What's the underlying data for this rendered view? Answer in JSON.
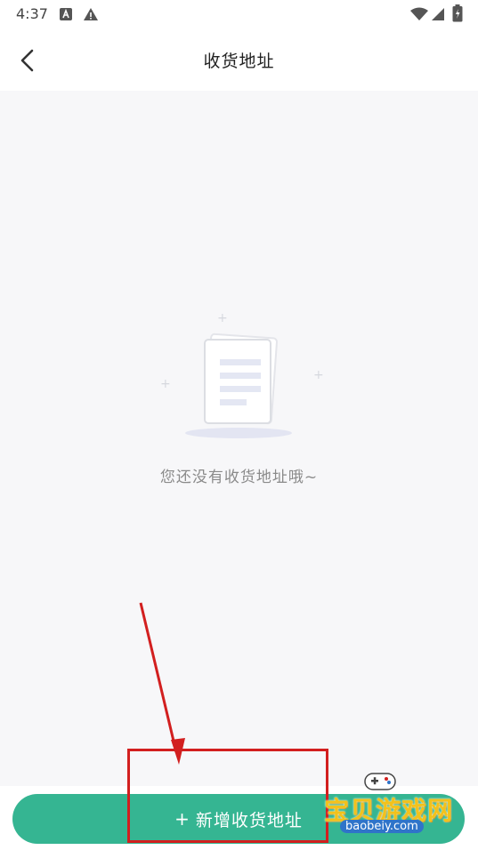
{
  "status_bar": {
    "time": "4:37"
  },
  "header": {
    "title": "收货地址"
  },
  "empty_state": {
    "message": "您还没有收货地址哦~"
  },
  "footer": {
    "add_button_label": "新增收货地址",
    "add_button_prefix": "+"
  },
  "watermark": {
    "text": "宝贝游戏网",
    "domain": "baobeiy.com"
  },
  "colors": {
    "accent": "#35b592",
    "annotation": "#d21f1f",
    "background": "#f7f7f9"
  },
  "icons": {
    "back": "chevron-left-icon",
    "empty": "document-icon",
    "wifi": "wifi-icon",
    "battery": "battery-icon"
  }
}
